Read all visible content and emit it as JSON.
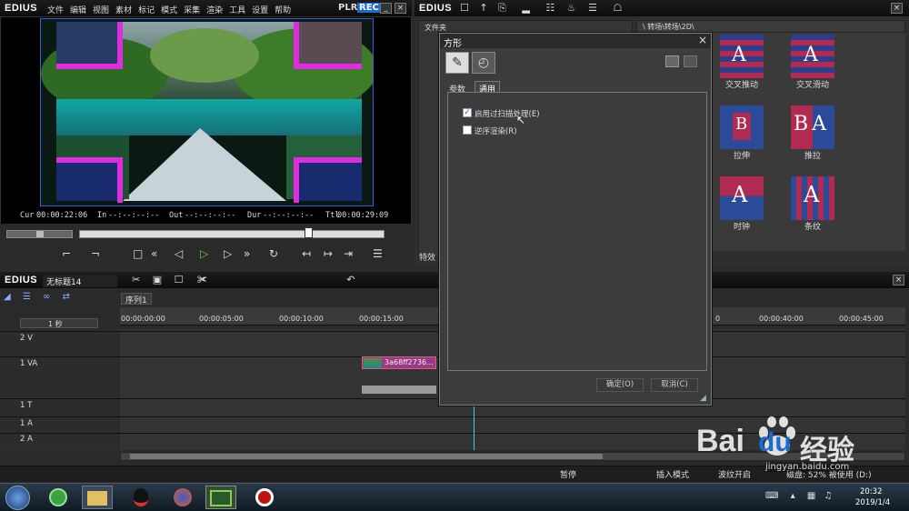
{
  "player": {
    "logo": "EDIUS",
    "menu": [
      "文件",
      "编辑",
      "视图",
      "素材",
      "标记",
      "模式",
      "采集",
      "渲染",
      "工具",
      "设置",
      "帮助"
    ],
    "plr": "PLR",
    "rec": "REC",
    "cur_label": "Cur",
    "cur_value": "00:00:22:06",
    "in_label": "In",
    "in_value": "--:--:--:--",
    "out_label": "Out",
    "out_value": "--:--:--:--",
    "dur_label": "Dur",
    "dur_value": "--:--:--:--",
    "ttl_label": "Ttl",
    "ttl_value": "00:00:29:09"
  },
  "library": {
    "logo": "EDIUS",
    "folder_label": "文件夹",
    "path": "\\ 转场\\转场\\2D\\",
    "effects_tab": "特效",
    "items": [
      {
        "label": "交叉推动",
        "letter": "A"
      },
      {
        "label": "交叉滑动",
        "letter": "A"
      },
      {
        "label": "拉伸",
        "letter": "B"
      },
      {
        "label": "推拉",
        "letter": "BA"
      },
      {
        "label": "时钟",
        "letter": "A"
      },
      {
        "label": "条纹",
        "letter": "A"
      }
    ]
  },
  "dialog": {
    "title": "方形",
    "tab_params": "参数",
    "tab_general": "通用",
    "checkbox1_label": "启用过扫描处理(E)",
    "checkbox1_checked": true,
    "checkbox2_label": "逆序渲染(R)",
    "checkbox2_checked": false,
    "ok_label": "确定(O)",
    "cancel_label": "取消(C)"
  },
  "timeline": {
    "logo": "EDIUS",
    "project": "无标题14",
    "sequence_tab": "序列1",
    "scale": "1 秒",
    "ruler": [
      "00:00:00:00",
      "00:00:05:00",
      "00:00:10:00",
      "00:00:15:00",
      "00:00:40:00",
      "00:00:45:00"
    ],
    "ruler_partial": [
      "0"
    ],
    "tracks": [
      "2 V",
      "1 VA",
      "1 T",
      "1 A",
      "2 A"
    ],
    "clip_name": "3a68ff2736..."
  },
  "status": {
    "pause": "暂停",
    "insert_mode": "插入模式",
    "ripple": "波纹开启",
    "disk": "磁盘: 52% 被使用 (D:)"
  },
  "taskbar": {
    "time": "20:32",
    "date": "2019/1/4"
  },
  "watermark": {
    "brand": "Bai",
    "brand2": "du",
    "cn": "经验",
    "url": "jingyan.baidu.com"
  }
}
